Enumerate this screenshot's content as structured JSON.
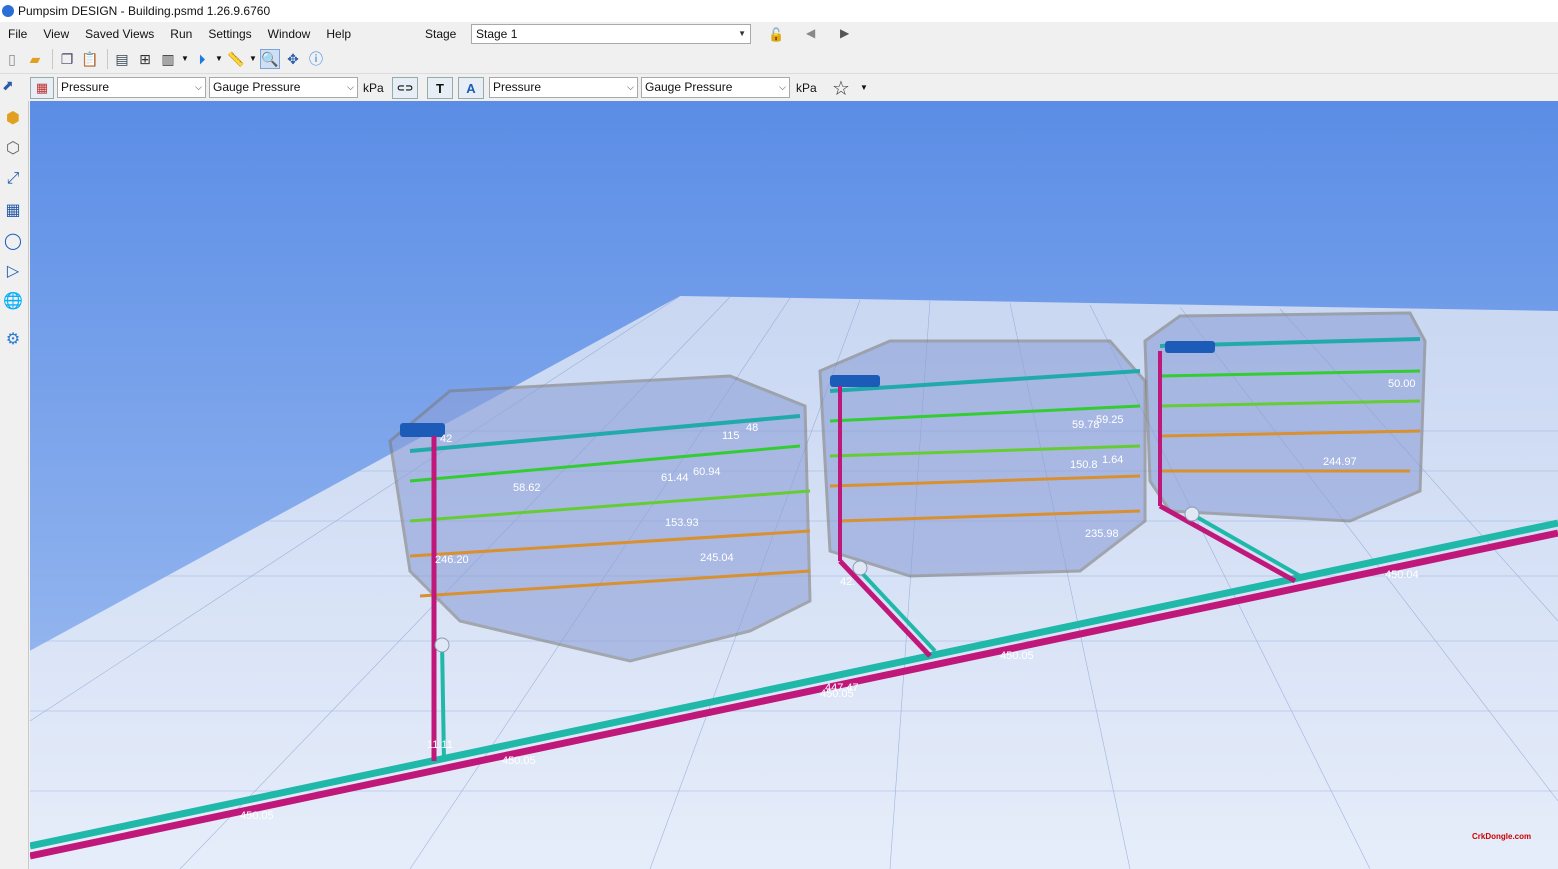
{
  "window": {
    "title": "Pumpsim DESIGN - Building.psmd 1.26.9.6760"
  },
  "menu": [
    "File",
    "View",
    "Saved Views",
    "Run",
    "Settings",
    "Window",
    "Help"
  ],
  "stage": {
    "label": "Stage",
    "value": "Stage 1"
  },
  "toolbar2": {
    "color_by": "Pressure",
    "color_type": "Gauge Pressure",
    "color_unit": "kPa",
    "text_by": "Pressure",
    "text_type": "Gauge Pressure",
    "text_unit": "kPa",
    "text_button": "T"
  },
  "labels": {
    "l1": "42",
    "l2": "115",
    "l3": "48",
    "l4": "58.62",
    "l5": "60.94",
    "l6": "61.44",
    "l7": "153.93",
    "l8": "245.04",
    "l9": "246.20",
    "l10": "59.78",
    "l11": "59.25",
    "l12": "150.8",
    "l13": "1.64",
    "l14": "235.98",
    "l15": "42.",
    "l16": "50.00",
    "l17": "244.97",
    "l18": "450.04",
    "l19": "450.05",
    "l20": "447.47",
    "l21": "450.05",
    "l22": "450.05",
    "l23": "450.05",
    "l24": "11.11"
  },
  "watermark": "CrkDongle.com"
}
